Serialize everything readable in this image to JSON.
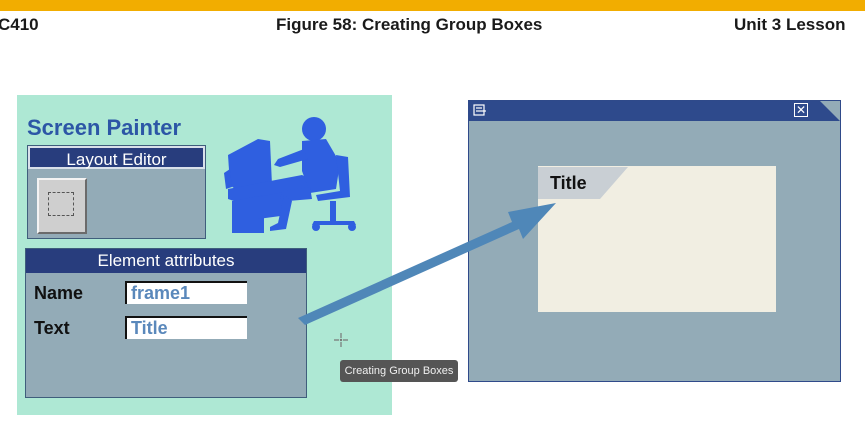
{
  "header": {
    "left": "C410",
    "center": "Figure 58: Creating Group Boxes",
    "right": "Unit 3 Lesson"
  },
  "screen_painter": {
    "title": "Screen Painter",
    "layout_editor": {
      "title": "Layout Editor"
    },
    "element_attributes": {
      "title": "Element attributes",
      "fields": [
        {
          "label": "Name",
          "value": "frame1"
        },
        {
          "label": "Text",
          "value": "Title"
        }
      ]
    }
  },
  "window": {
    "group_box_title": "Title"
  },
  "tooltip": "Creating Group Boxes",
  "colors": {
    "accent_bar": "#f2ad00",
    "panel_bg": "#aee8d4",
    "title_blue": "#2c56a6",
    "dark_blue": "#283d7d",
    "steel": "#93abb7",
    "arrow": "#4f87b8"
  }
}
